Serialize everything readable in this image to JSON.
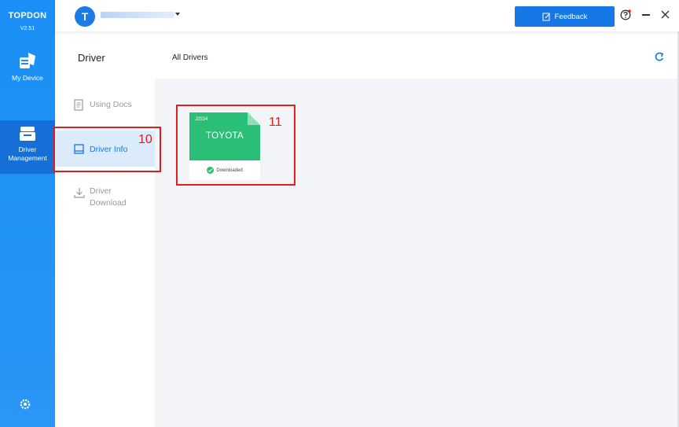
{
  "app": {
    "brand": "TOPDON",
    "version": "V2.51"
  },
  "rail": {
    "my_device": "My Device",
    "driver_management_line1": "Driver",
    "driver_management_line2": "Management"
  },
  "header": {
    "avatar_letter": "T",
    "feedback_label": "Feedback"
  },
  "subnav": {
    "title": "Driver",
    "items": [
      {
        "label": "Using Docs"
      },
      {
        "label": "Driver Info"
      },
      {
        "label_line1": "Driver",
        "label_line2": "Download"
      }
    ]
  },
  "content": {
    "title": "All Drivers",
    "cards": [
      {
        "code": "J2534",
        "name": "TOYOTA",
        "status": "Downloaded"
      }
    ]
  },
  "annotations": {
    "callout_10": "10",
    "callout_11": "11"
  },
  "colors": {
    "primary": "#1677e6",
    "rail": "#1a8ff7",
    "active_nav_bg": "#dcebfb",
    "card_green": "#2bbe76",
    "callout_red": "#e21d1d"
  }
}
